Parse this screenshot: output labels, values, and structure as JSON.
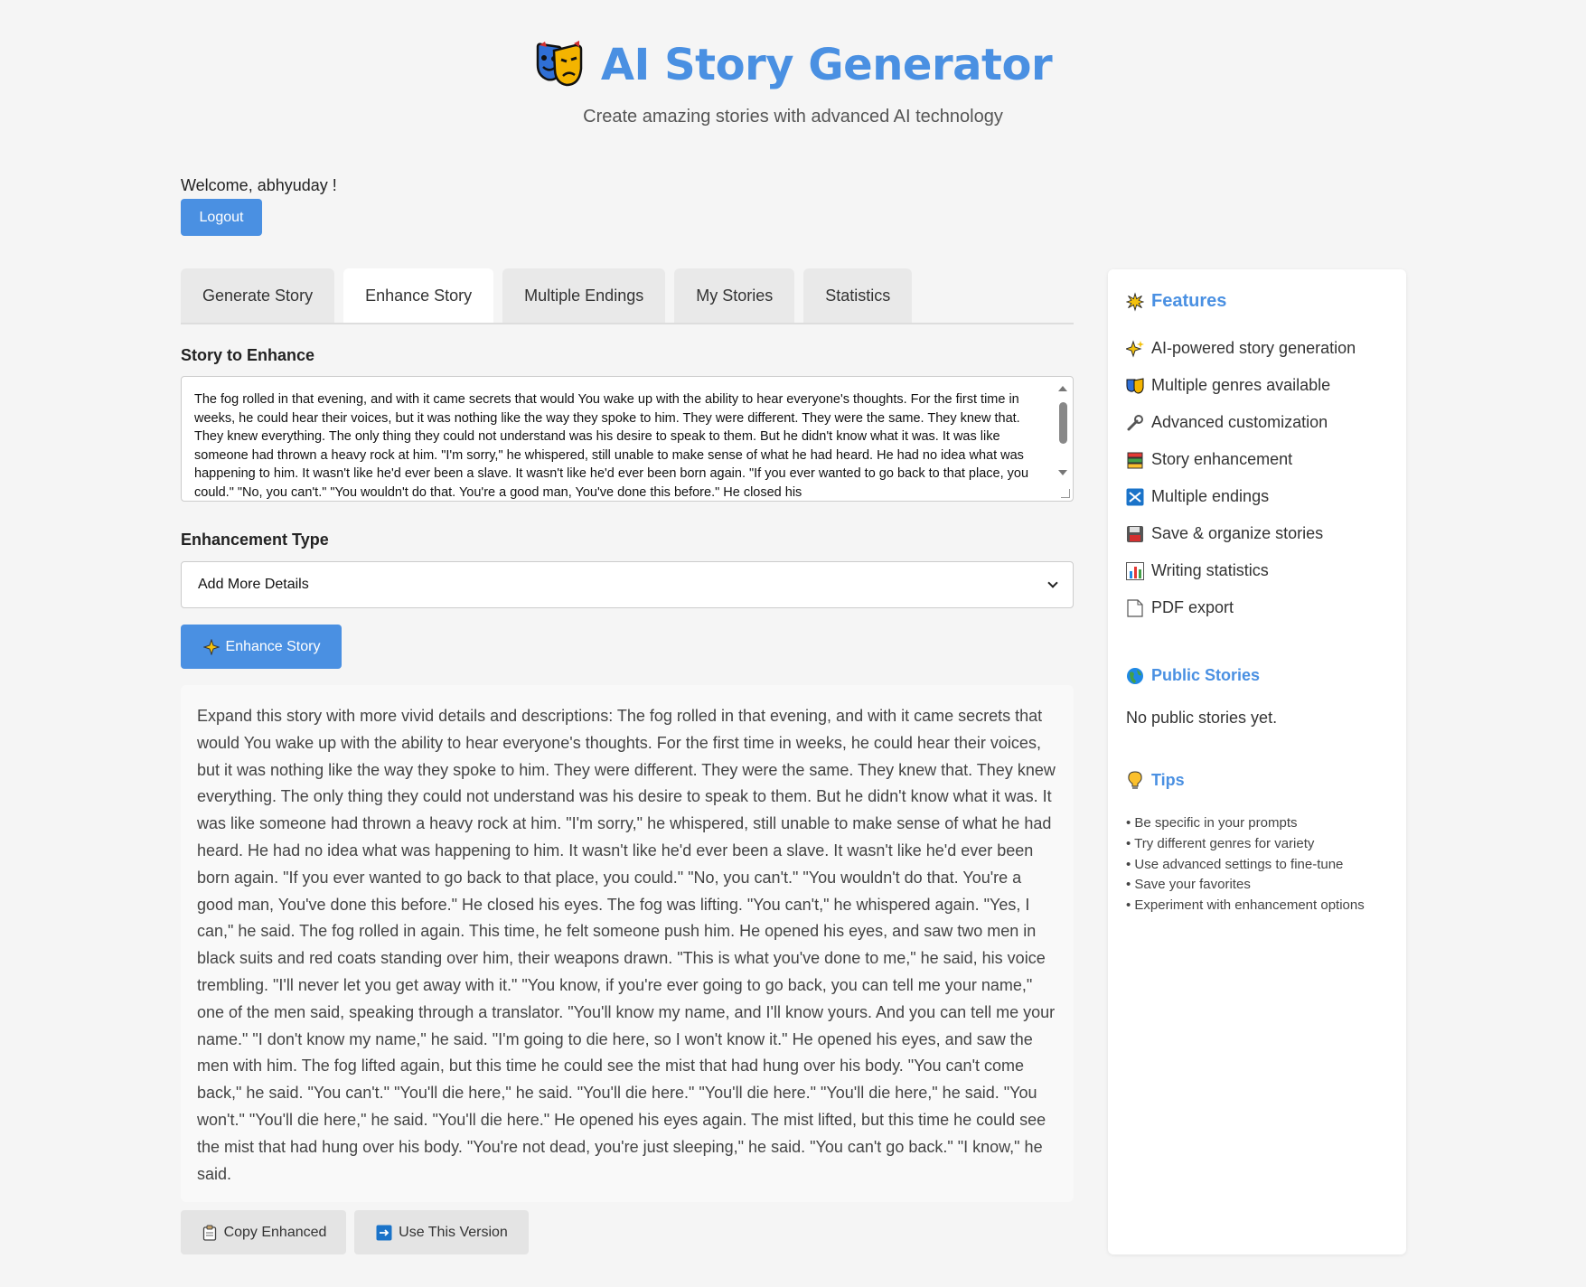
{
  "header": {
    "title": "AI Story Generator",
    "subtitle": "Create amazing stories with advanced AI technology"
  },
  "user": {
    "welcome": "Welcome, abhyuday !",
    "logout_label": "Logout"
  },
  "tabs": [
    {
      "label": "Generate Story",
      "active": false
    },
    {
      "label": "Enhance Story",
      "active": true
    },
    {
      "label": "Multiple Endings",
      "active": false
    },
    {
      "label": "My Stories",
      "active": false
    },
    {
      "label": "Statistics",
      "active": false
    }
  ],
  "enhance": {
    "story_label": "Story to Enhance",
    "story_text": "The fog rolled in that evening, and with it came secrets that would You wake up with the ability to hear everyone's thoughts. For the first time in weeks, he could hear their voices, but it was nothing like the way they spoke to him. They were different. They were the same. They knew that. They knew everything. The only thing they could not understand was his desire to speak to them. But he didn't know what it was. It was like someone had thrown a heavy rock at him. \"I'm sorry,\" he whispered, still unable to make sense of what he had heard. He had no idea what was happening to him. It wasn't like he'd ever been a slave. It wasn't like he'd ever been born again. \"If you ever wanted to go back to that place, you could.\" \"No, you can't.\" \"You wouldn't do that. You're a good man, You've done this before.\" He closed his",
    "type_label": "Enhancement Type",
    "type_value": "Add More Details",
    "button_label": "Enhance Story",
    "result_text": "Expand this story with more vivid details and descriptions: The fog rolled in that evening, and with it came secrets that would You wake up with the ability to hear everyone's thoughts. For the first time in weeks, he could hear their voices, but it was nothing like the way they spoke to him. They were different. They were the same. They knew that. They knew everything. The only thing they could not understand was his desire to speak to them. But he didn't know what it was. It was like someone had thrown a heavy rock at him. \"I'm sorry,\" he whispered, still unable to make sense of what he had heard. He had no idea what was happening to him. It wasn't like he'd ever been a slave. It wasn't like he'd ever been born again. \"If you ever wanted to go back to that place, you could.\" \"No, you can't.\" \"You wouldn't do that. You're a good man, You've done this before.\" He closed his eyes. The fog was lifting. \"You can't,\" he whispered again. \"Yes, I can,\" he said. The fog rolled in again. This time, he felt someone push him. He opened his eyes, and saw two men in black suits and red coats standing over him, their weapons drawn. \"This is what you've done to me,\" he said, his voice trembling. \"I'll never let you get away with it.\" \"You know, if you're ever going to go back, you can tell me your name,\" one of the men said, speaking through a translator. \"You'll know my name, and I'll know yours. And you can tell me your name.\" \"I don't know my name,\" he said. \"I'm going to die here, so I won't know it.\" He opened his eyes, and saw the men with him. The fog lifted again, but this time he could see the mist that had hung over his body. \"You can't come back,\" he said. \"You can't.\" \"You'll die here,\" he said. \"You'll die here.\" \"You'll die here.\" \"You'll die here,\" he said. \"You won't.\" \"You'll die here,\" he said. \"You'll die here.\" He opened his eyes again. The mist lifted, but this time he could see the mist that had hung over his body. \"You're not dead, you're just sleeping,\" he said. \"You can't go back.\" \"I know,\" he said.",
    "copy_label": "Copy Enhanced",
    "use_label": "Use This Version"
  },
  "sidebar": {
    "features_title": "Features",
    "features": [
      {
        "label": "AI-powered story generation",
        "icon": "sparkles-icon"
      },
      {
        "label": "Multiple genres available",
        "icon": "theater-masks-icon"
      },
      {
        "label": "Advanced customization",
        "icon": "wrench-icon"
      },
      {
        "label": "Story enhancement",
        "icon": "books-icon"
      },
      {
        "label": "Multiple endings",
        "icon": "shuffle-icon"
      },
      {
        "label": "Save & organize stories",
        "icon": "floppy-disk-icon"
      },
      {
        "label": "Writing statistics",
        "icon": "bar-chart-icon"
      },
      {
        "label": "PDF export",
        "icon": "document-icon"
      }
    ],
    "public_title": "Public Stories",
    "public_empty": "No public stories yet.",
    "tips_title": "Tips",
    "tips": [
      "• Be specific in your prompts",
      "• Try different genres for variety",
      "• Use advanced settings to fine-tune",
      "• Save your favorites",
      "• Experiment with enhancement options"
    ]
  },
  "colors": {
    "accent": "#4a90e2",
    "background": "#f5f5f5"
  }
}
